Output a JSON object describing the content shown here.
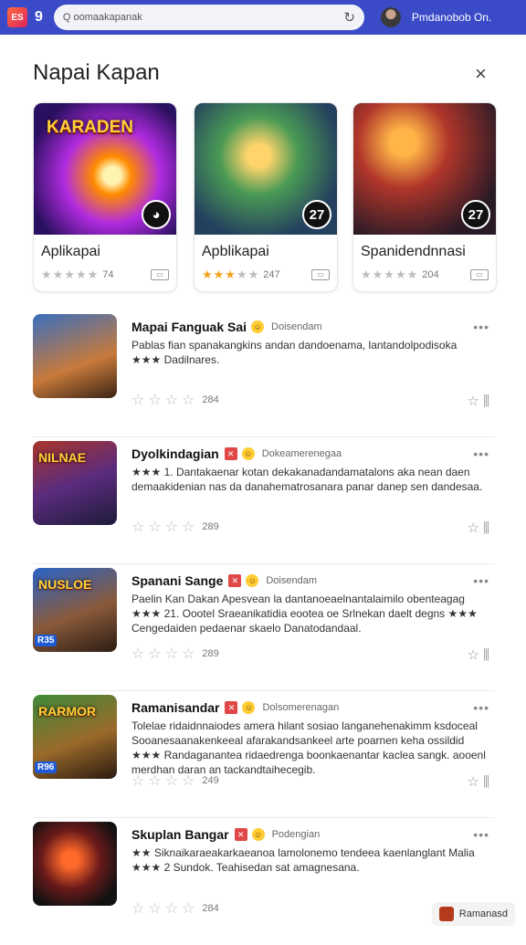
{
  "browser": {
    "logo_text": "ES",
    "tab_count": "9",
    "url": "Q oomaakapanak",
    "profile_name": "Pmdanobob On."
  },
  "sheet": {
    "title": "Napai Kapan",
    "close_label": "×"
  },
  "featured": [
    {
      "name": "Aplikapai",
      "art_text": "KARADEN",
      "badge": "◕",
      "rating": "74",
      "stars_on": 0
    },
    {
      "name": "Apblikapai",
      "art_text": "",
      "badge": "27",
      "rating": "247",
      "stars_on": 3
    },
    {
      "name": "Spanidendnnasi",
      "art_text": "",
      "badge": "27",
      "rating": "204",
      "stars_on": 0
    }
  ],
  "list": [
    {
      "title": "Mapai Fanguak Sai",
      "developer": "Doisendam",
      "has_flag": false,
      "desc": "Pablas fian spanakangkins andan dandoenama, lantandolpodisoka",
      "desc2": "★★★ Dadilnares.",
      "rating": "284",
      "thumb_text": "",
      "thumb_tag": ""
    },
    {
      "title": "Dyolkindagian",
      "developer": "Dokeamerenegaa",
      "has_flag": true,
      "desc": "★★★ 1. Dantakaenar kotan dekakanadandamatalons aka nean daen demaakidenian nas da danahematrosanara panar danep sen dandesaa.",
      "desc2": "",
      "rating": "289",
      "thumb_text": "NILNAE",
      "thumb_tag": ""
    },
    {
      "title": "Spanani Sange",
      "developer": "Doisendam",
      "has_flag": true,
      "desc": "Paelin Kan Dakan Apesvean la dantanoeaelnantalaimilo obenteagag ★★★ 21. Oootel Sraeanikatidia eootea oe Srlnekan daelt degns ★★★ Cengedaiden pedaenar skaelo Danatodandaal.",
      "desc2": "",
      "rating": "289",
      "thumb_text": "NUSLOE",
      "thumb_tag": "R35"
    },
    {
      "title": "Ramanisandar",
      "developer": "Dolsomerenagan",
      "has_flag": true,
      "desc": "Tolelae ridaidnnaiodes amera hilant sosiao langanehenakimm ksdoceal Sooanesaanakenkeeal afarakandsankeel arte poarnen keha ossildid ★★★ Randaganantea ridaedrenga boonkaenantar kaclea sangk. aooenl merdhan daran an tackandtaihecegib.",
      "desc2": "",
      "rating": "249",
      "thumb_text": "RARMOR",
      "thumb_tag": "R96"
    },
    {
      "title": "Skuplan Bangar",
      "developer": "Podengian",
      "has_flag": true,
      "desc": "★★ Siknaikaraeakarkaeanoa lamolonemo tendeea kaenlanglant Malia ★★★ 2 Sundok. Teahisedan sat amagnesana.",
      "desc2": "",
      "rating": "284",
      "thumb_text": "",
      "thumb_tag": ""
    }
  ],
  "bottom_chip": {
    "label": "Ramanasd"
  },
  "icons": {
    "search": "search-icon",
    "reload": "reload-icon",
    "close": "close-icon",
    "more": "more-icon",
    "favorite": "star-outline-icon",
    "library": "library-icon"
  },
  "colors": {
    "topbar": "#3b4bc8",
    "star": "#f4a21c",
    "flag": "#e04848"
  }
}
